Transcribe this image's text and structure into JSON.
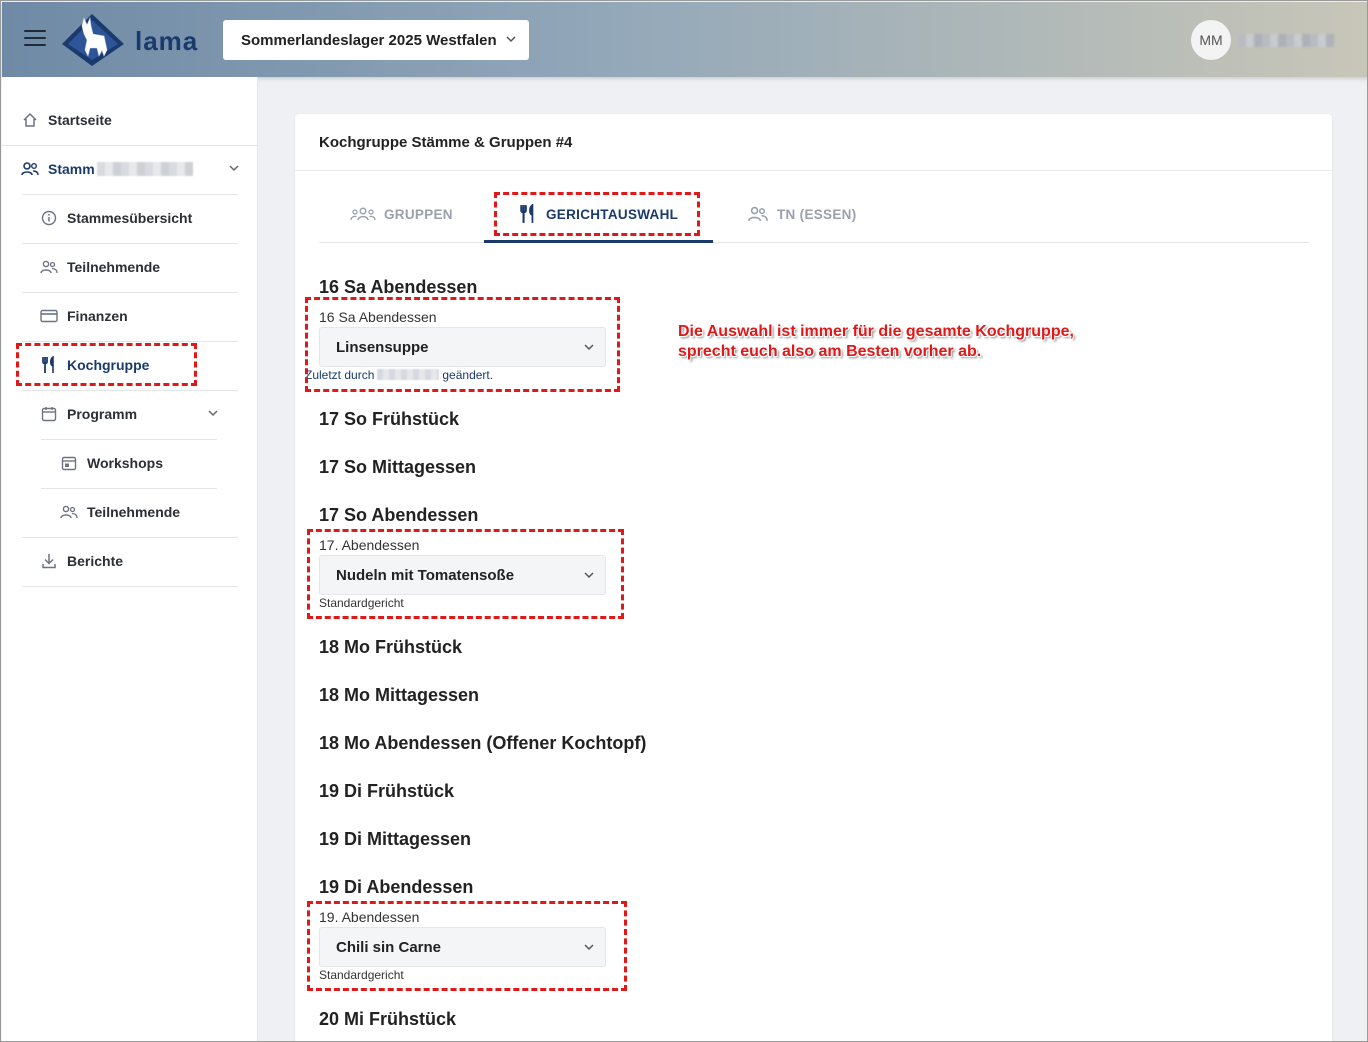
{
  "header": {
    "logo_text": "lama",
    "event_select": "Sommerlandeslager 2025 Westfalen",
    "avatar_initials": "MM"
  },
  "sidebar": {
    "items": [
      {
        "label": "Startseite",
        "icon": "home-icon"
      },
      {
        "label": "Stamm",
        "icon": "users-icon"
      },
      {
        "label": "Stammesübersicht",
        "icon": "info-icon"
      },
      {
        "label": "Teilnehmende",
        "icon": "people-icon"
      },
      {
        "label": "Finanzen",
        "icon": "credit-card-icon"
      },
      {
        "label": "Kochgruppe",
        "icon": "fork-knife-icon"
      },
      {
        "label": "Programm",
        "icon": "calendar-icon"
      },
      {
        "label": "Workshops",
        "icon": "calendar-icon"
      },
      {
        "label": "Teilnehmende",
        "icon": "people-icon"
      },
      {
        "label": "Berichte",
        "icon": "download-icon"
      }
    ]
  },
  "card": {
    "title": "Kochgruppe Stämme & Gruppen #4",
    "tabs": [
      {
        "label": "GRUPPEN",
        "icon": "groups-icon"
      },
      {
        "label": "GERICHTAUSWAHL",
        "icon": "fork-knife-icon"
      },
      {
        "label": "TN (ESSEN)",
        "icon": "people-icon"
      }
    ]
  },
  "meals": [
    {
      "heading": "16 Sa Abendessen",
      "field_label": "16 Sa Abendessen",
      "selected": "Linsensuppe",
      "hint_prefix": "Zuletzt durch",
      "hint_suffix": "geändert."
    },
    {
      "heading": "17 So Frühstück"
    },
    {
      "heading": "17 So Mittagessen"
    },
    {
      "heading": "17 So Abendessen",
      "field_label": "17. Abendessen",
      "selected": "Nudeln mit Tomatensoße",
      "hint": "Standardgericht"
    },
    {
      "heading": "18 Mo Frühstück"
    },
    {
      "heading": "18 Mo Mittagessen"
    },
    {
      "heading": "18 Mo Abendessen (Offener Kochtopf)"
    },
    {
      "heading": "19 Di Frühstück"
    },
    {
      "heading": "19 Di Mittagessen"
    },
    {
      "heading": "19 Di Abendessen",
      "field_label": "19. Abendessen",
      "selected": "Chili sin Carne",
      "hint": "Standardgericht"
    },
    {
      "heading": "20 Mi Frühstück"
    }
  ],
  "annotation": {
    "line1": "Die Auswahl ist immer für die gesamte Kochgruppe,",
    "line2": "sprecht euch also am Besten vorher ab.",
    "color": "#e01818"
  },
  "colors": {
    "accent": "#1a3a6e"
  }
}
